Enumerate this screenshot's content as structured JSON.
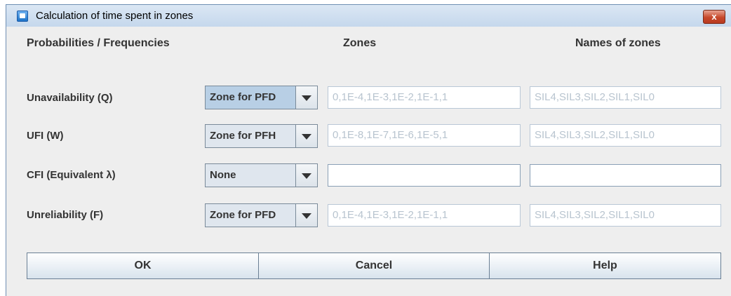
{
  "window": {
    "title": "Calculation of time spent in zones",
    "close_label": "x"
  },
  "headers": {
    "probabilities": "Probabilities / Frequencies",
    "zones": "Zones",
    "names": "Names of zones"
  },
  "rows": [
    {
      "label": "Unavailability (Q)",
      "zone_type": "Zone for PFD",
      "zones": "0,1E-4,1E-3,1E-2,1E-1,1",
      "names": "SIL4,SIL3,SIL2,SIL1,SIL0"
    },
    {
      "label": "UFI (W)",
      "zone_type": "Zone for PFH",
      "zones": "0,1E-8,1E-7,1E-6,1E-5,1",
      "names": "SIL4,SIL3,SIL2,SIL1,SIL0"
    },
    {
      "label": "CFI (Equivalent λ)",
      "zone_type": "None",
      "zones": "",
      "names": ""
    },
    {
      "label": "Unreliability (F)",
      "zone_type": "Zone for PFD",
      "zones": "0,1E-4,1E-3,1E-2,1E-1,1",
      "names": "SIL4,SIL3,SIL2,SIL1,SIL0"
    }
  ],
  "buttons": {
    "ok": "OK",
    "cancel": "Cancel",
    "help": "Help"
  },
  "colors": {
    "titlebar": "#c4d7ec",
    "panel": "#eeeeee",
    "close_button": "#c7482b",
    "placeholder_text": "#b8c4cf"
  },
  "icons": {
    "app": "window-app-icon",
    "close": "close-icon",
    "dropdown": "chevron-down-icon"
  }
}
